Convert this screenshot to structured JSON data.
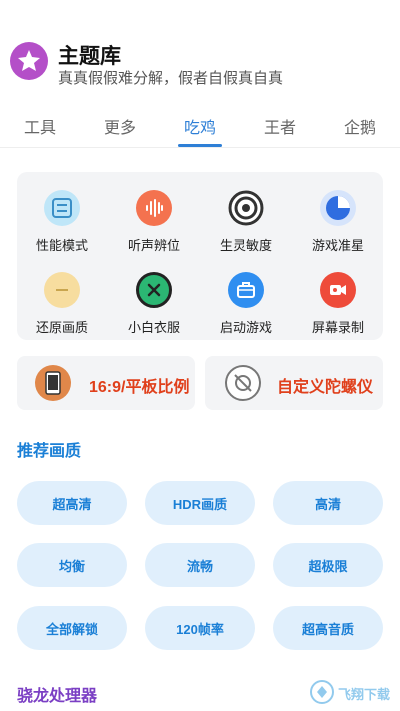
{
  "header": {
    "title": "主题库",
    "subtitle": "真真假假难分解，假者自假真自真"
  },
  "tabs": [
    {
      "label": "工具"
    },
    {
      "label": "更多"
    },
    {
      "label": "吃鸡",
      "active": true
    },
    {
      "label": "王者"
    },
    {
      "label": "企鹅"
    }
  ],
  "tools": [
    {
      "label": "性能模式",
      "icon": "performance-icon",
      "color": "#8fd3f5"
    },
    {
      "label": "听声辨位",
      "icon": "sound-wave-icon",
      "color": "#f4724f"
    },
    {
      "label": "生灵敏度",
      "icon": "target-icon",
      "color": "#3a3a3a"
    },
    {
      "label": "游戏准星",
      "icon": "crosshair-pie-icon",
      "color": "#2f6de0"
    },
    {
      "label": "还原画质",
      "icon": "restore-icon",
      "color": "#f5d38c"
    },
    {
      "label": "小白衣服",
      "icon": "close-circle-icon",
      "color": "#2bb673"
    },
    {
      "label": "启动游戏",
      "icon": "briefcase-icon",
      "color": "#2f8ef0"
    },
    {
      "label": "屏幕录制",
      "icon": "video-record-icon",
      "color": "#ee4b3a"
    }
  ],
  "wide_buttons": [
    {
      "label": "16:9/平板比例",
      "icon": "tablet-icon"
    },
    {
      "label": "自定义陀螺仪",
      "icon": "gyroscope-icon"
    }
  ],
  "quality_section": {
    "title": "推荐画质",
    "title_color": "#1a7fd6",
    "options": [
      "超高清",
      "HDR画质",
      "高清",
      "均衡",
      "流畅",
      "超极限",
      "全部解锁",
      "120帧率",
      "超高音质"
    ]
  },
  "processor_section": {
    "title": "骁龙处理器",
    "title_color": "#7b3fc4"
  },
  "watermark": "飞翔下载"
}
